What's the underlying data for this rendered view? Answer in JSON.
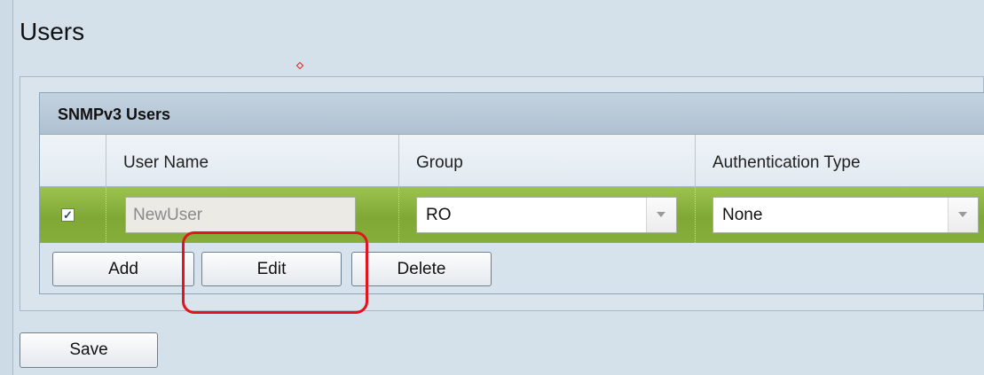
{
  "page": {
    "title": "Users"
  },
  "panel": {
    "title": "SNMPv3 Users",
    "columns": [
      "User Name",
      "Group",
      "Authentication Type"
    ]
  },
  "row": {
    "checked": true,
    "check_glyph": "✓",
    "username": "NewUser",
    "group": "RO",
    "auth_type": "None"
  },
  "actions": {
    "add": "Add",
    "edit": "Edit",
    "delete": "Delete"
  },
  "footer": {
    "save": "Save"
  },
  "colors": {
    "row_selected": "#86ae3a",
    "highlight": "#e3141e",
    "header": "#afc1d1"
  }
}
